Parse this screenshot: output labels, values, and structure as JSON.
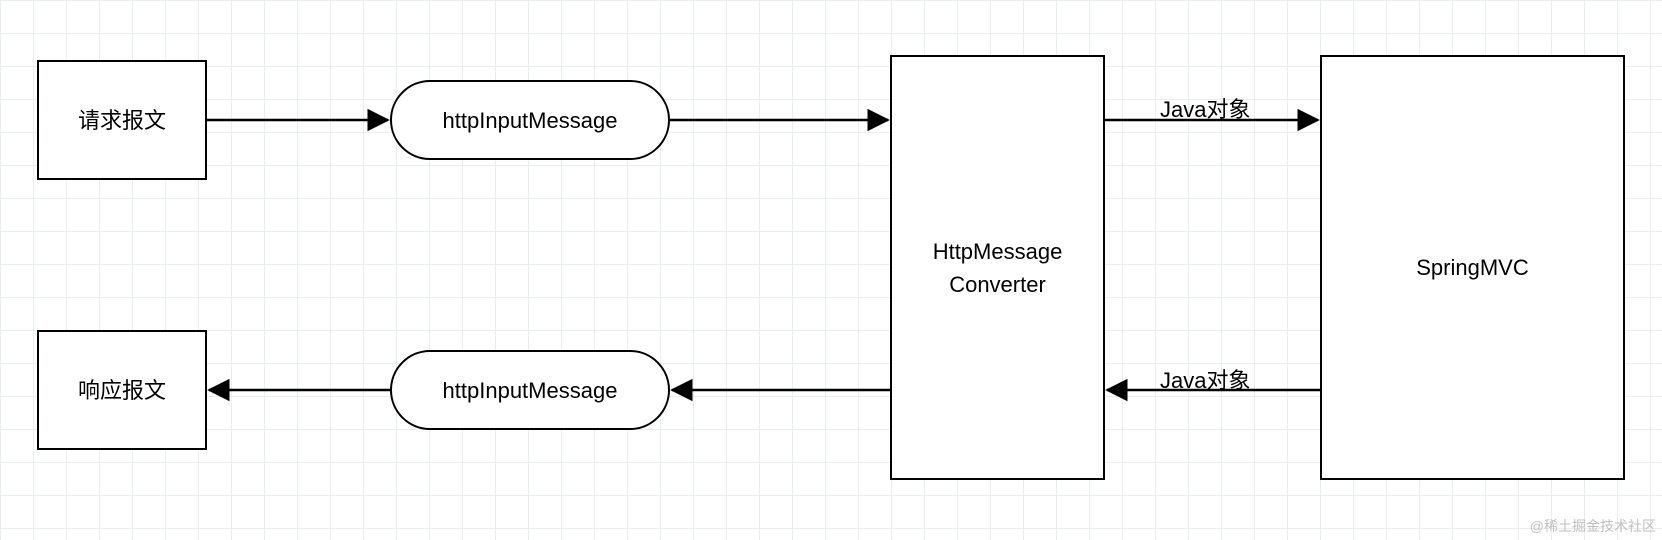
{
  "nodes": {
    "request": {
      "label": "请求报文"
    },
    "response": {
      "label": "响应报文"
    },
    "httpInputTop": {
      "label": "httpInputMessage"
    },
    "httpInputBottom": {
      "label": "httpInputMessage"
    },
    "converter": {
      "label": "HttpMessage\nConverter"
    },
    "springmvc": {
      "label": "SpringMVC"
    }
  },
  "edges": {
    "javaTop": {
      "label": "Java对象"
    },
    "javaBottom": {
      "label": "Java对象"
    }
  },
  "watermark": "@稀土掘金技术社区",
  "chart_data": {
    "type": "diagram",
    "title": "",
    "nodes": [
      {
        "id": "request",
        "label": "请求报文",
        "shape": "rect"
      },
      {
        "id": "response",
        "label": "响应报文",
        "shape": "rect"
      },
      {
        "id": "inMsgTop",
        "label": "httpInputMessage",
        "shape": "rounded-rect"
      },
      {
        "id": "inMsgBot",
        "label": "httpInputMessage",
        "shape": "rounded-rect"
      },
      {
        "id": "converter",
        "label": "HttpMessage Converter",
        "shape": "rect"
      },
      {
        "id": "springmvc",
        "label": "SpringMVC",
        "shape": "rect"
      }
    ],
    "edges": [
      {
        "from": "request",
        "to": "inMsgTop",
        "label": ""
      },
      {
        "from": "inMsgTop",
        "to": "converter",
        "label": ""
      },
      {
        "from": "converter",
        "to": "springmvc",
        "label": "Java对象"
      },
      {
        "from": "springmvc",
        "to": "converter",
        "label": "Java对象"
      },
      {
        "from": "converter",
        "to": "inMsgBot",
        "label": ""
      },
      {
        "from": "inMsgBot",
        "to": "response",
        "label": ""
      }
    ]
  }
}
